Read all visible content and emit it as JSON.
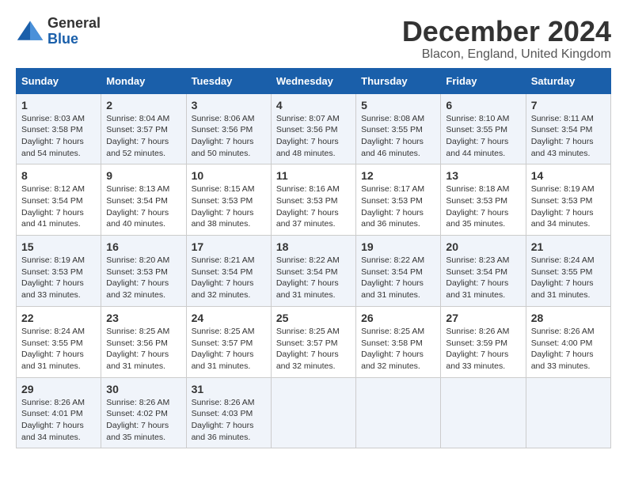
{
  "logo": {
    "line1": "General",
    "line2": "Blue"
  },
  "title": "December 2024",
  "subtitle": "Blacon, England, United Kingdom",
  "days_of_week": [
    "Sunday",
    "Monday",
    "Tuesday",
    "Wednesday",
    "Thursday",
    "Friday",
    "Saturday"
  ],
  "weeks": [
    [
      {
        "day": "1",
        "sunrise": "8:03 AM",
        "sunset": "3:58 PM",
        "daylight": "7 hours and 54 minutes."
      },
      {
        "day": "2",
        "sunrise": "8:04 AM",
        "sunset": "3:57 PM",
        "daylight": "7 hours and 52 minutes."
      },
      {
        "day": "3",
        "sunrise": "8:06 AM",
        "sunset": "3:56 PM",
        "daylight": "7 hours and 50 minutes."
      },
      {
        "day": "4",
        "sunrise": "8:07 AM",
        "sunset": "3:56 PM",
        "daylight": "7 hours and 48 minutes."
      },
      {
        "day": "5",
        "sunrise": "8:08 AM",
        "sunset": "3:55 PM",
        "daylight": "7 hours and 46 minutes."
      },
      {
        "day": "6",
        "sunrise": "8:10 AM",
        "sunset": "3:55 PM",
        "daylight": "7 hours and 44 minutes."
      },
      {
        "day": "7",
        "sunrise": "8:11 AM",
        "sunset": "3:54 PM",
        "daylight": "7 hours and 43 minutes."
      }
    ],
    [
      {
        "day": "8",
        "sunrise": "8:12 AM",
        "sunset": "3:54 PM",
        "daylight": "7 hours and 41 minutes."
      },
      {
        "day": "9",
        "sunrise": "8:13 AM",
        "sunset": "3:54 PM",
        "daylight": "7 hours and 40 minutes."
      },
      {
        "day": "10",
        "sunrise": "8:15 AM",
        "sunset": "3:53 PM",
        "daylight": "7 hours and 38 minutes."
      },
      {
        "day": "11",
        "sunrise": "8:16 AM",
        "sunset": "3:53 PM",
        "daylight": "7 hours and 37 minutes."
      },
      {
        "day": "12",
        "sunrise": "8:17 AM",
        "sunset": "3:53 PM",
        "daylight": "7 hours and 36 minutes."
      },
      {
        "day": "13",
        "sunrise": "8:18 AM",
        "sunset": "3:53 PM",
        "daylight": "7 hours and 35 minutes."
      },
      {
        "day": "14",
        "sunrise": "8:19 AM",
        "sunset": "3:53 PM",
        "daylight": "7 hours and 34 minutes."
      }
    ],
    [
      {
        "day": "15",
        "sunrise": "8:19 AM",
        "sunset": "3:53 PM",
        "daylight": "7 hours and 33 minutes."
      },
      {
        "day": "16",
        "sunrise": "8:20 AM",
        "sunset": "3:53 PM",
        "daylight": "7 hours and 32 minutes."
      },
      {
        "day": "17",
        "sunrise": "8:21 AM",
        "sunset": "3:54 PM",
        "daylight": "7 hours and 32 minutes."
      },
      {
        "day": "18",
        "sunrise": "8:22 AM",
        "sunset": "3:54 PM",
        "daylight": "7 hours and 31 minutes."
      },
      {
        "day": "19",
        "sunrise": "8:22 AM",
        "sunset": "3:54 PM",
        "daylight": "7 hours and 31 minutes."
      },
      {
        "day": "20",
        "sunrise": "8:23 AM",
        "sunset": "3:54 PM",
        "daylight": "7 hours and 31 minutes."
      },
      {
        "day": "21",
        "sunrise": "8:24 AM",
        "sunset": "3:55 PM",
        "daylight": "7 hours and 31 minutes."
      }
    ],
    [
      {
        "day": "22",
        "sunrise": "8:24 AM",
        "sunset": "3:55 PM",
        "daylight": "7 hours and 31 minutes."
      },
      {
        "day": "23",
        "sunrise": "8:25 AM",
        "sunset": "3:56 PM",
        "daylight": "7 hours and 31 minutes."
      },
      {
        "day": "24",
        "sunrise": "8:25 AM",
        "sunset": "3:57 PM",
        "daylight": "7 hours and 31 minutes."
      },
      {
        "day": "25",
        "sunrise": "8:25 AM",
        "sunset": "3:57 PM",
        "daylight": "7 hours and 32 minutes."
      },
      {
        "day": "26",
        "sunrise": "8:25 AM",
        "sunset": "3:58 PM",
        "daylight": "7 hours and 32 minutes."
      },
      {
        "day": "27",
        "sunrise": "8:26 AM",
        "sunset": "3:59 PM",
        "daylight": "7 hours and 33 minutes."
      },
      {
        "day": "28",
        "sunrise": "8:26 AM",
        "sunset": "4:00 PM",
        "daylight": "7 hours and 33 minutes."
      }
    ],
    [
      {
        "day": "29",
        "sunrise": "8:26 AM",
        "sunset": "4:01 PM",
        "daylight": "7 hours and 34 minutes."
      },
      {
        "day": "30",
        "sunrise": "8:26 AM",
        "sunset": "4:02 PM",
        "daylight": "7 hours and 35 minutes."
      },
      {
        "day": "31",
        "sunrise": "8:26 AM",
        "sunset": "4:03 PM",
        "daylight": "7 hours and 36 minutes."
      },
      null,
      null,
      null,
      null
    ]
  ],
  "labels": {
    "sunrise": "Sunrise: ",
    "sunset": "Sunset: ",
    "daylight": "Daylight: "
  }
}
